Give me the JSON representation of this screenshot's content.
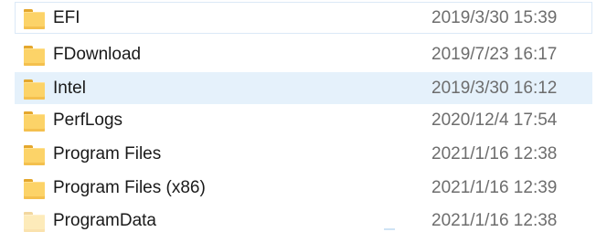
{
  "files": [
    {
      "name": "EFI",
      "date_modified": "2019/3/30 15:39",
      "icon": "folder-icon",
      "state": "focused"
    },
    {
      "name": "FDownload",
      "date_modified": "2019/7/23 16:17",
      "icon": "folder-icon",
      "state": "normal"
    },
    {
      "name": "Intel",
      "date_modified": "2019/3/30 16:12",
      "icon": "folder-icon",
      "state": "hovered"
    },
    {
      "name": "PerfLogs",
      "date_modified": "2020/12/4 17:54",
      "icon": "folder-icon",
      "state": "normal"
    },
    {
      "name": "Program Files",
      "date_modified": "2021/1/16 12:38",
      "icon": "folder-icon",
      "state": "normal"
    },
    {
      "name": "Program Files (x86)",
      "date_modified": "2021/1/16 12:39",
      "icon": "folder-icon",
      "state": "normal"
    },
    {
      "name": "ProgramData",
      "date_modified": "2021/1/16 12:38",
      "icon": "folder-icon",
      "state": "hidden"
    }
  ],
  "colors": {
    "folder": "#fcd368",
    "folder_tab": "#e4a72d",
    "hover_background": "#e5f1fb",
    "focus_border": "#dbe9f7",
    "name_text": "#1a1a1a",
    "date_text": "#6d6d6d"
  }
}
